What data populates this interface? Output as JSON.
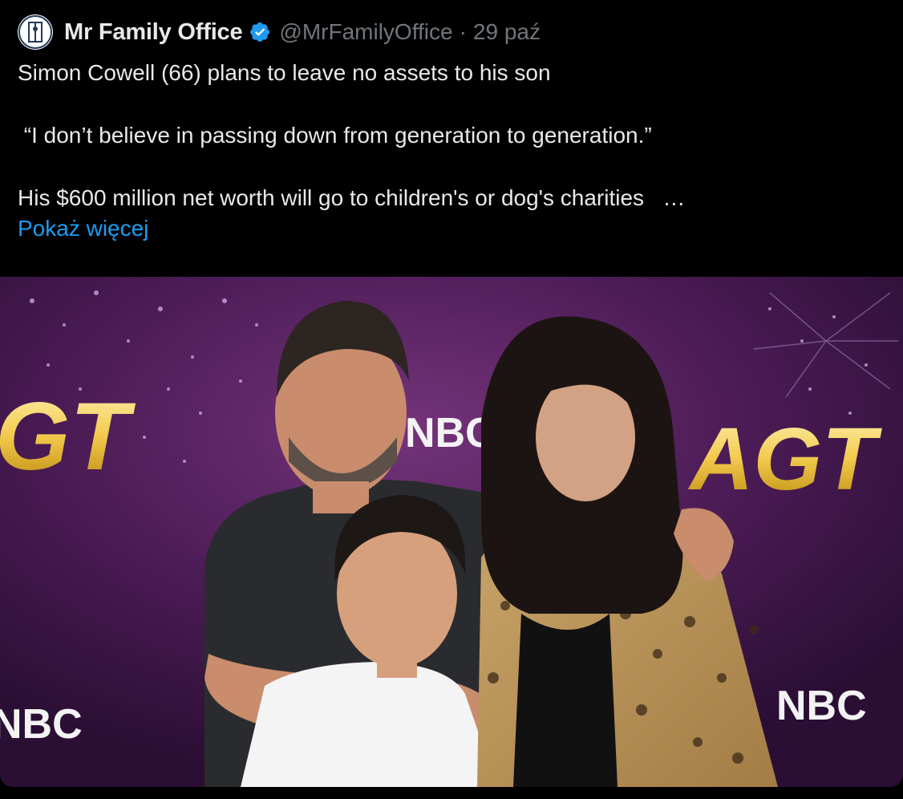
{
  "author": {
    "display_name": "Mr Family Office",
    "handle": "@MrFamilyOffice",
    "separator": "·",
    "date": "29 paź",
    "verified_icon": "verified-badge-icon",
    "verified_color": "#1d9bf0"
  },
  "post": {
    "line1": "Simon Cowell (66) plans to leave no assets to his son",
    "line2": " “I don’t believe in passing down from generation to generation.”",
    "line3": "His $600 million net worth will go to children's or dog's charities   …",
    "show_more": "Pokaż więcej"
  },
  "media": {
    "logo_text_left": "GT",
    "logo_text_right": "AGT",
    "nbc_center": "NBC",
    "nbc_bottom_left": "NBC",
    "nbc_bottom_right": "NBC"
  },
  "colors": {
    "background": "#000000",
    "text": "#e7e9ea",
    "muted": "#71767b",
    "link": "#1d9bf0",
    "backdrop_purple": "#5a2262",
    "agt_gold": "#f2c94c"
  }
}
